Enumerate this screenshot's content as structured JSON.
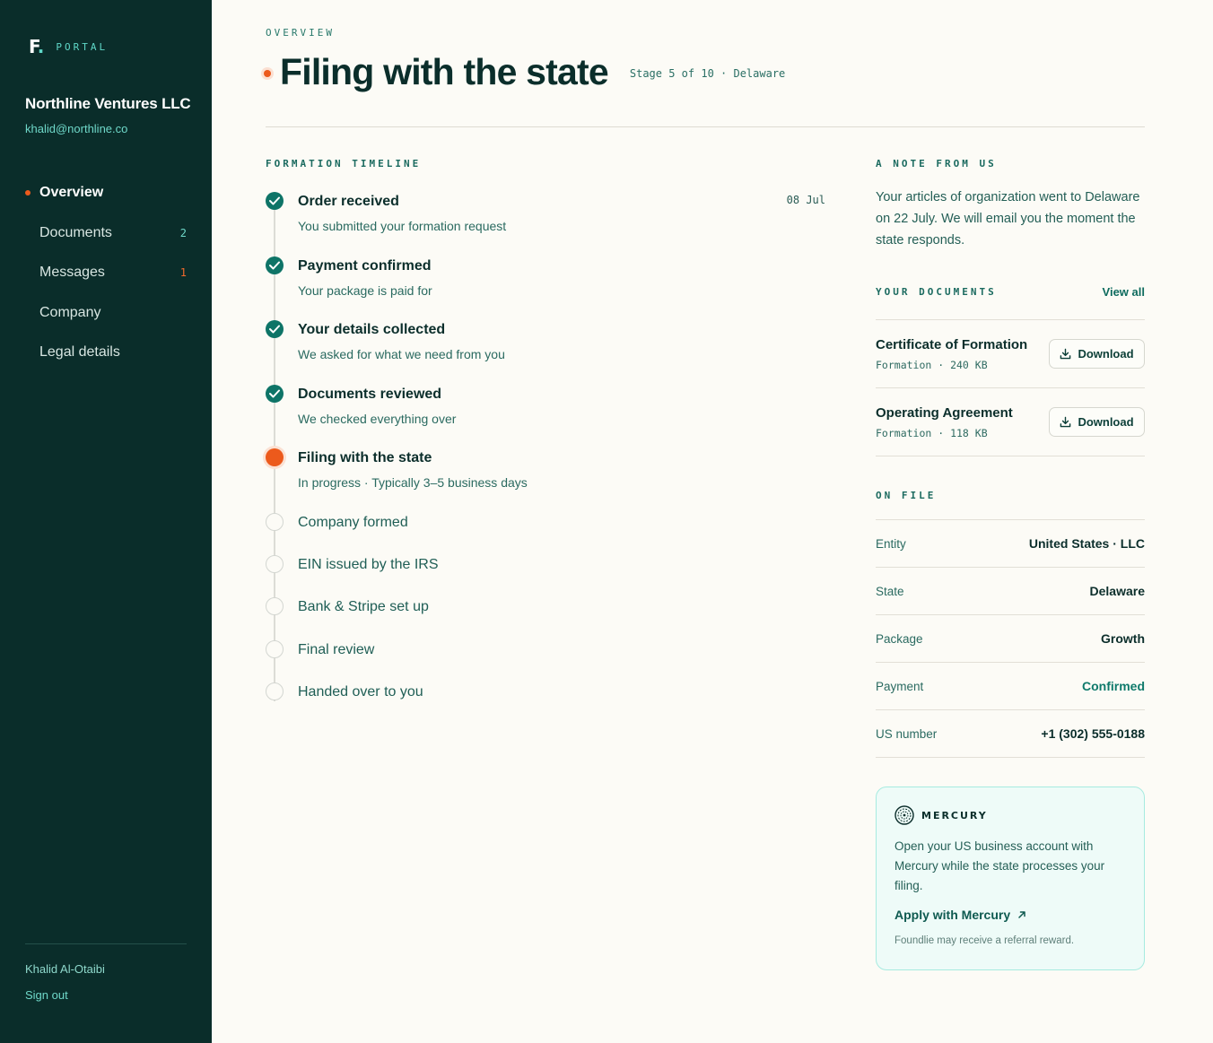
{
  "sidebar": {
    "brand_mark": "F",
    "brand_dot": ".",
    "brand_label": "PORTAL",
    "company_name": "Northline Ventures LLC",
    "company_email": "khalid@northline.co",
    "nav": [
      {
        "label": "Overview",
        "count": "",
        "active": true
      },
      {
        "label": "Documents",
        "count": "2"
      },
      {
        "label": "Messages",
        "count": "1"
      },
      {
        "label": "Company",
        "count": ""
      },
      {
        "label": "Legal details",
        "count": ""
      }
    ],
    "user_name": "Khalid Al-Otaibi",
    "sign_out": "Sign out"
  },
  "header": {
    "eyebrow": "OVERVIEW",
    "title": "Filing with the state",
    "stage": "Stage 5 of 10 · Delaware"
  },
  "timeline": {
    "label": "FORMATION TIMELINE",
    "steps": [
      {
        "title": "Order received",
        "subtitle": "You submitted your formation request",
        "date": "08 Jul",
        "status": "done"
      },
      {
        "title": "Payment confirmed",
        "subtitle": "Your package is paid for",
        "status": "done"
      },
      {
        "title": "Your details collected",
        "subtitle": "We asked for what we need from you",
        "status": "done"
      },
      {
        "title": "Documents reviewed",
        "subtitle": "We checked everything over",
        "status": "done"
      },
      {
        "title": "Filing with the state",
        "subtitle": "In progress · Typically 3–5 business days",
        "status": "current"
      },
      {
        "title": "Company formed",
        "status": "pending"
      },
      {
        "title": "EIN issued by the IRS",
        "status": "pending"
      },
      {
        "title": "Bank & Stripe set up",
        "status": "pending"
      },
      {
        "title": "Final review",
        "status": "pending"
      },
      {
        "title": "Handed over to you",
        "status": "pending"
      }
    ]
  },
  "note": {
    "label": "A NOTE FROM US",
    "text": "Your articles of organization went to Delaware on 22 July. We will email you the moment the state responds."
  },
  "documents": {
    "label": "YOUR DOCUMENTS",
    "view_all": "View all",
    "items": [
      {
        "name": "Certificate of Formation",
        "meta": "Formation · 240 KB",
        "action": "Download"
      },
      {
        "name": "Operating Agreement",
        "meta": "Formation · 118 KB",
        "action": "Download"
      }
    ]
  },
  "on_file": {
    "label": "ON FILE",
    "rows": [
      {
        "key": "Entity",
        "value": "United States · LLC"
      },
      {
        "key": "State",
        "value": "Delaware"
      },
      {
        "key": "Package",
        "value": "Growth"
      },
      {
        "key": "Payment",
        "value": "Confirmed"
      },
      {
        "key": "US number",
        "value": "+1 (302) 555-0188"
      }
    ]
  },
  "promo": {
    "brand": "MERCURY",
    "text": "Open your US business account with Mercury while the state processes your filing.",
    "link": "Apply with Mercury",
    "fine_print": "Foundlie may receive a referral reward."
  },
  "colors": {
    "sidebar_bg": "#0a2d2a",
    "accent_teal": "#0e7467",
    "accent_orange": "#ec5a1c",
    "page_bg": "#fcfbf6"
  }
}
